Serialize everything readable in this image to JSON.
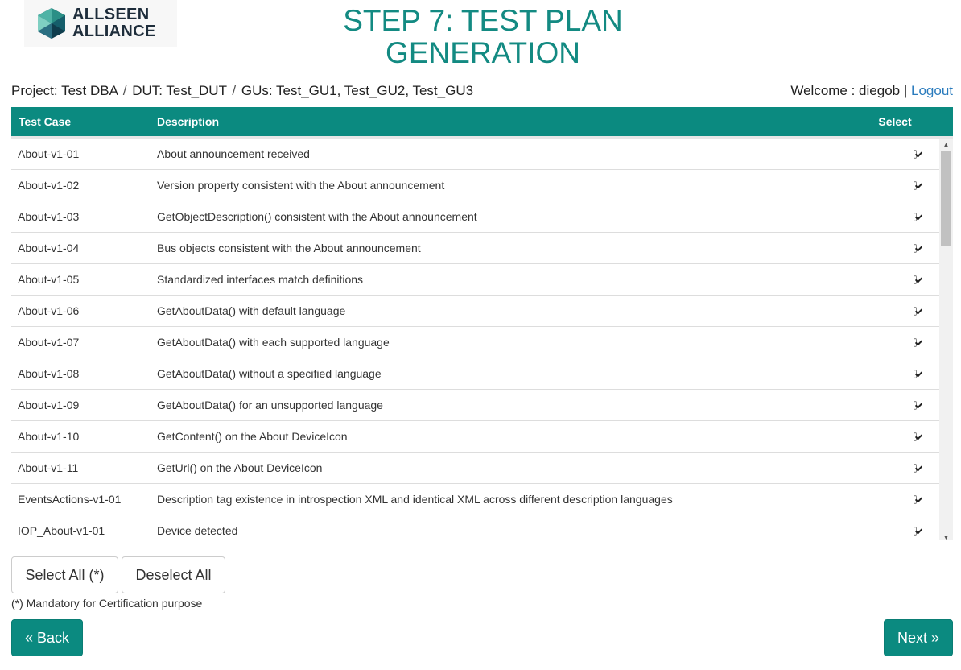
{
  "logo": {
    "line1": "ALLSEEN",
    "line2": "ALLIANCE"
  },
  "title": {
    "line1": "STEP 7: TEST PLAN",
    "line2": "GENERATION"
  },
  "project_bar": {
    "project_label": "Project:",
    "project_value": "Test DBA",
    "dut_label": "DUT:",
    "dut_value": "Test_DUT",
    "gus_label": "GUs:",
    "gus_value": "Test_GU1, Test_GU2, Test_GU3"
  },
  "user": {
    "welcome_label": "Welcome : diegob",
    "separator": "|",
    "logout_label": "Logout"
  },
  "table": {
    "headers": {
      "test_case": "Test Case",
      "description": "Description",
      "select": "Select"
    },
    "rows": [
      {
        "id": "About-v1-01",
        "description": "About announcement received",
        "selected": true
      },
      {
        "id": "About-v1-02",
        "description": "Version property consistent with the About announcement",
        "selected": true
      },
      {
        "id": "About-v1-03",
        "description": "GetObjectDescription() consistent with the About announcement",
        "selected": true
      },
      {
        "id": "About-v1-04",
        "description": "Bus objects consistent with the About announcement",
        "selected": true
      },
      {
        "id": "About-v1-05",
        "description": "Standardized interfaces match definitions",
        "selected": true
      },
      {
        "id": "About-v1-06",
        "description": "GetAboutData() with default language",
        "selected": true
      },
      {
        "id": "About-v1-07",
        "description": "GetAboutData() with each supported language",
        "selected": true
      },
      {
        "id": "About-v1-08",
        "description": "GetAboutData() without a specified language",
        "selected": true
      },
      {
        "id": "About-v1-09",
        "description": "GetAboutData() for an unsupported language",
        "selected": true
      },
      {
        "id": "About-v1-10",
        "description": "GetContent() on the About DeviceIcon",
        "selected": true
      },
      {
        "id": "About-v1-11",
        "description": "GetUrl() on the About DeviceIcon",
        "selected": true
      },
      {
        "id": "EventsActions-v1-01",
        "description": "Description tag existence in introspection XML and identical XML across different description languages",
        "selected": true
      },
      {
        "id": "IOP_About-v1-01",
        "description": "Device detected",
        "selected": true
      }
    ]
  },
  "buttons": {
    "select_all": "Select All (*)",
    "deselect_all": "Deselect All",
    "back": "« Back",
    "next": "Next »"
  },
  "footnote": "(*) Mandatory for Certification purpose",
  "colors": {
    "accent": "#0b8a80",
    "title": "#138a82",
    "link": "#2a7bbd"
  }
}
